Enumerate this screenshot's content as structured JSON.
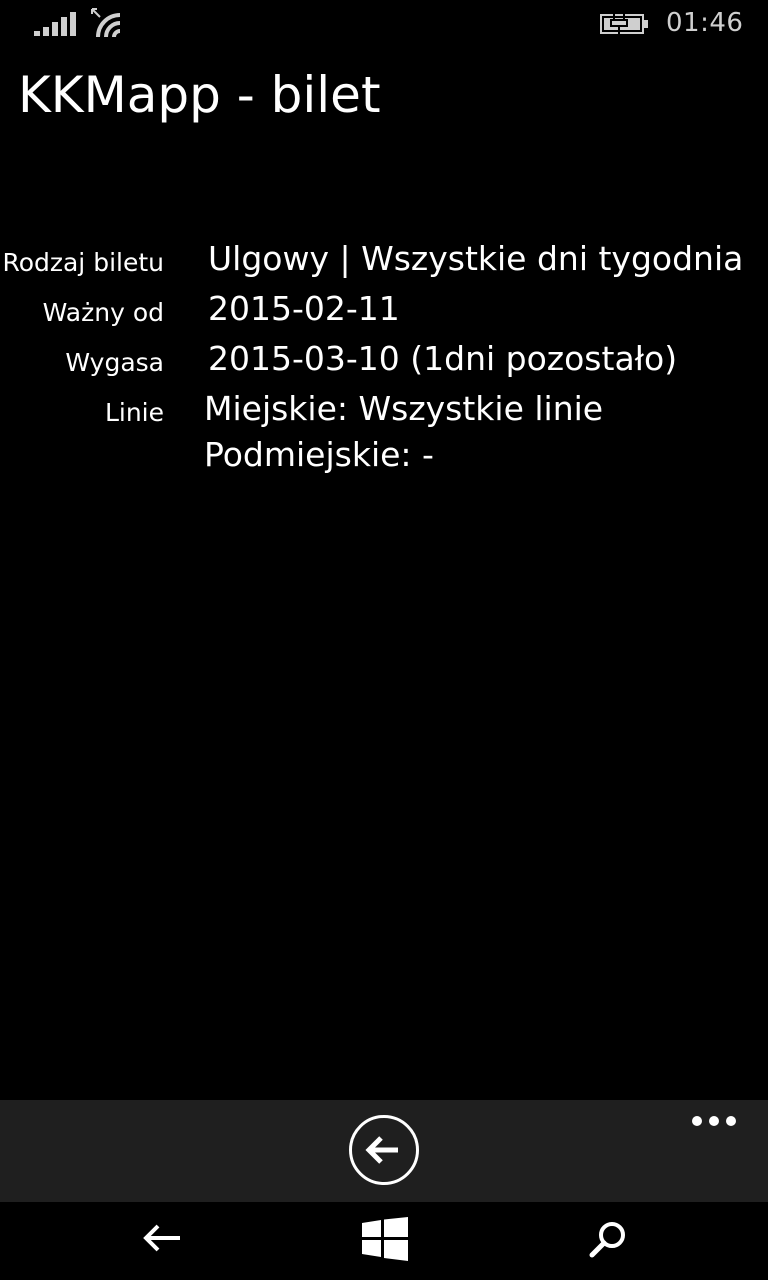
{
  "status_bar": {
    "time": "01:46",
    "icons": [
      "signal-icon",
      "wifi-icon",
      "battery-charging-icon"
    ]
  },
  "header": {
    "title": "KKMapp - bilet"
  },
  "ticket": {
    "rows": [
      {
        "label": "Rodzaj biletu",
        "value": "Ulgowy | Wszystkie dni tygodnia"
      },
      {
        "label": "Ważny od",
        "value": "2015-02-11"
      },
      {
        "label": "Wygasa",
        "value": "2015-03-10 (1dni pozostało)"
      },
      {
        "label": "Linie",
        "values": [
          "Miejskie: Wszystkie linie",
          "Podmiejskie: -"
        ]
      }
    ]
  },
  "app_bar": {
    "buttons": [
      "back-circle-icon"
    ],
    "more": "more-dots-icon"
  },
  "nav_bar": {
    "icons": [
      "back-arrow-icon",
      "windows-start-icon",
      "search-icon"
    ]
  },
  "colors": {
    "background": "#000000",
    "text": "#ffffff",
    "app_bar": "#1f1f1f"
  }
}
